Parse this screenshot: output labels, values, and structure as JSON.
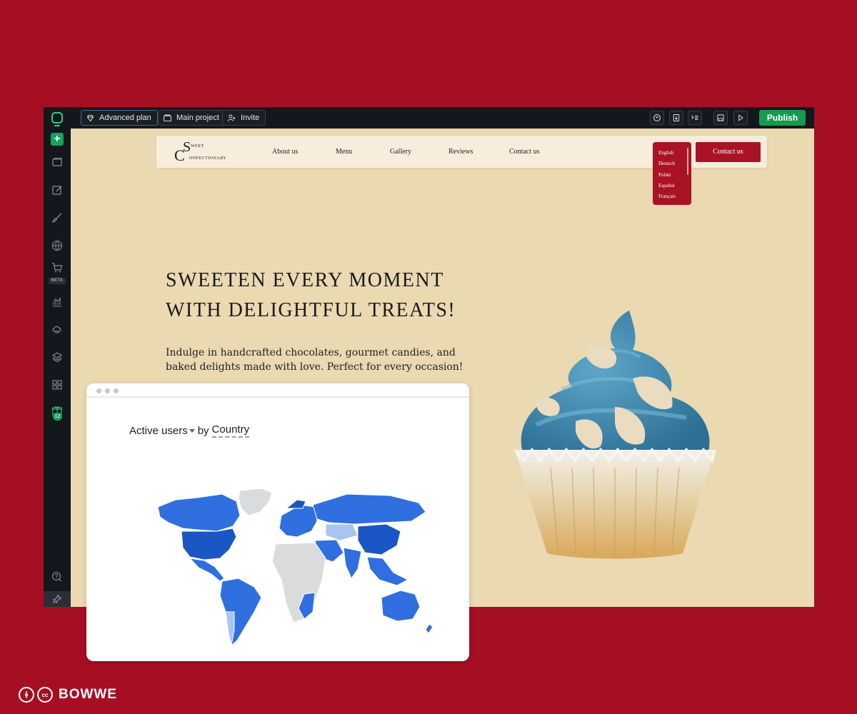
{
  "toolbar": {
    "plan_label": "Advanced plan",
    "project_label": "Main project",
    "invite_label": "Invite",
    "publish_label": "Publish"
  },
  "sidebar": {
    "beta_label": "BETA",
    "gift_count": "12"
  },
  "site": {
    "logo": {
      "first": "S",
      "second": "C",
      "word1": "WEET",
      "word2": "ONFECTIONARY"
    },
    "nav": [
      "About us",
      "Menu",
      "Gallery",
      "Reviews",
      "Contact us"
    ],
    "languages": [
      "English",
      "Deutsch",
      "Polski",
      "Español",
      "Français"
    ],
    "contact_button": "Contact us",
    "hero_title": "SWEETEN EVERY MOMENT WITH DELIGHTFUL TREATS!",
    "hero_text": "Indulge in handcrafted chocolates, gourmet candies, and baked delights made with love. Perfect for every occasion!"
  },
  "analytics": {
    "metric": "Active users",
    "dimension_prefix": "by",
    "dimension": "Country"
  },
  "brand": {
    "name": "BOWWE",
    "cc_label": "cc"
  },
  "colors": {
    "background": "#a60f23",
    "accent": "#a91325",
    "publish": "#159a4f",
    "map_dark": "#1a56c4",
    "map_mid": "#2f6fe0",
    "map_light": "#a8c4f2",
    "map_none": "#dadbdd"
  }
}
